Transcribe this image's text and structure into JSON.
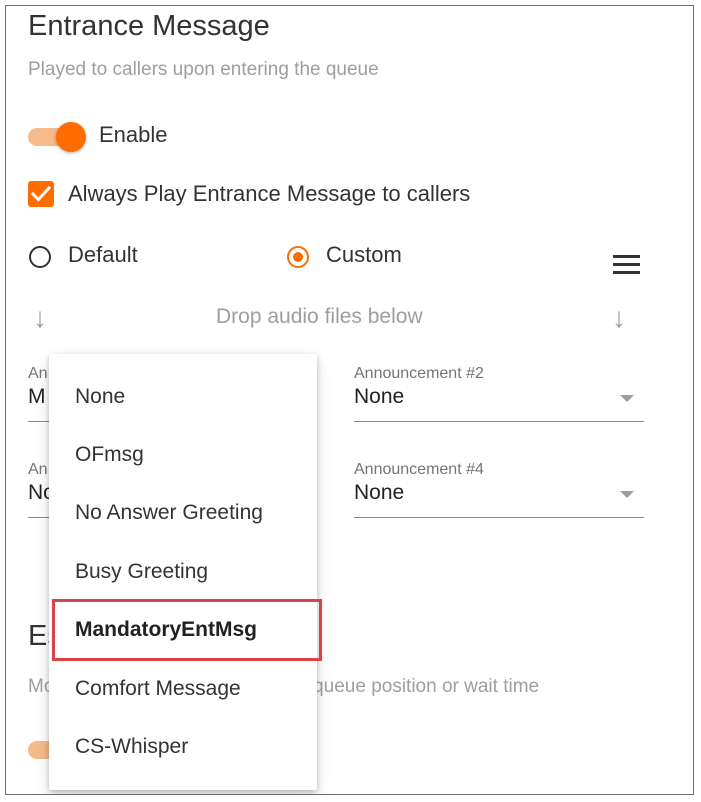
{
  "section": {
    "title": "Entrance Message",
    "subtitle": "Played to callers upon entering the queue"
  },
  "enable_toggle": {
    "label": "Enable",
    "on": true
  },
  "always_play": {
    "label": "Always Play Entrance Message to callers",
    "checked": true
  },
  "message_type": {
    "default_label": "Default",
    "custom_label": "Custom",
    "selected": "Custom"
  },
  "drop_zone": {
    "text": "Drop audio files below"
  },
  "announcements": [
    {
      "label": "An",
      "value": "M"
    },
    {
      "label": "Announcement #2",
      "value": "None"
    },
    {
      "label": "An",
      "value": "No"
    },
    {
      "label": "Announcement #4",
      "value": "None"
    }
  ],
  "next_section": {
    "title": "Es",
    "subtitle": "Mo                                       ed on queue position or wait time"
  },
  "dropdown": {
    "options": [
      "None",
      "OFmsg",
      "No Answer Greeting",
      "Busy Greeting",
      "MandatoryEntMsg",
      "Comfort Message",
      "CS-Whisper"
    ],
    "selected": "MandatoryEntMsg"
  },
  "colors": {
    "accent": "#ff6d00",
    "accent_light": "#f7ba8a",
    "highlight_box": "#d9434a"
  },
  "icons": [
    "check-icon",
    "menu-icon",
    "arrow-down-icon"
  ]
}
